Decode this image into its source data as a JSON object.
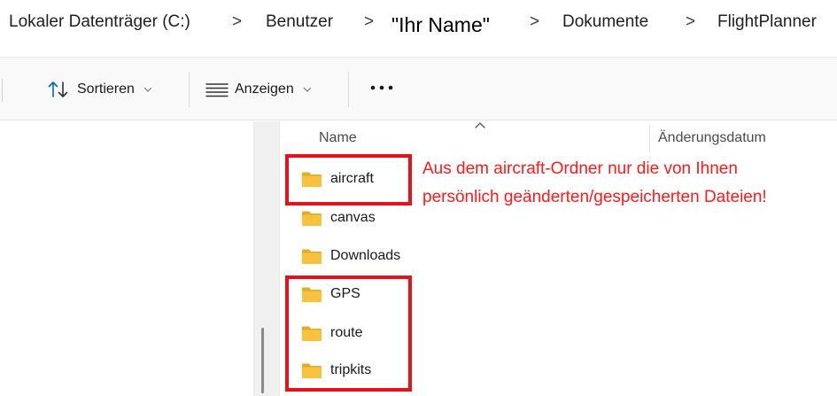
{
  "breadcrumb": {
    "items": [
      "Lokaler Datenträger (C:)",
      "Benutzer",
      "\"Ihr Name\"",
      "Dokumente",
      "FlightPlanner"
    ],
    "separator": ">"
  },
  "toolbar": {
    "sort_label": "Sortieren",
    "view_label": "Anzeigen",
    "more_label": "..."
  },
  "columns": {
    "name": "Name",
    "modified": "Änderungsdatum"
  },
  "folders": [
    "aircraft",
    "canvas",
    "Downloads",
    "GPS",
    "route",
    "tripkits"
  ],
  "annotation": {
    "line1": "Aus dem aircraft-Ordner nur die von Ihnen",
    "line2": "persönlich geänderten/gespeicherten Dateien!",
    "color": "#ff1a1a"
  },
  "colors": {
    "highlight": "#e8101a",
    "folder": "#f7c33e",
    "accent": "#0067c0"
  }
}
